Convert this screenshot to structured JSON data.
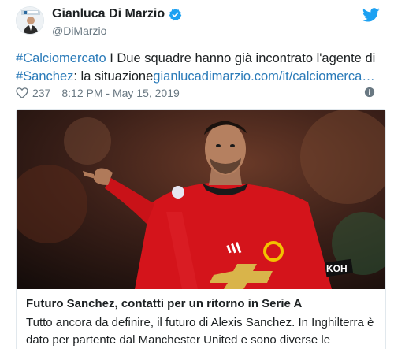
{
  "author": {
    "display_name": "Gianluca Di Marzio",
    "handle": "@DiMarzio",
    "avatar_icon": "avatar-photo",
    "verified_icon": "verified-badge-icon"
  },
  "tweet": {
    "hashtag1": "#Calciomercato",
    "text1": " I Due squadre hanno già incontrato l'agente di ",
    "hashtag2": "#Sanchez",
    "text2": ": la situazione",
    "link": "gianlucadimarzio.com/it/calciomerca…",
    "likes": "237",
    "timestamp": "8:12 PM - May 15, 2019"
  },
  "card": {
    "title": "Futuro Sanchez, contatti per un ritorno in Serie A",
    "description": "Tutto ancora da definire, il futuro di Alexis Sanchez. In Inghilterra è dato per partente dal Manchester United e sono diverse le",
    "image_alt": "player-photo",
    "shirt_text": "KOH"
  },
  "colors": {
    "link": "#2b7bb9",
    "brand": "#1da1f2",
    "muted": "#697882",
    "shirt_red": "#d4141b"
  }
}
